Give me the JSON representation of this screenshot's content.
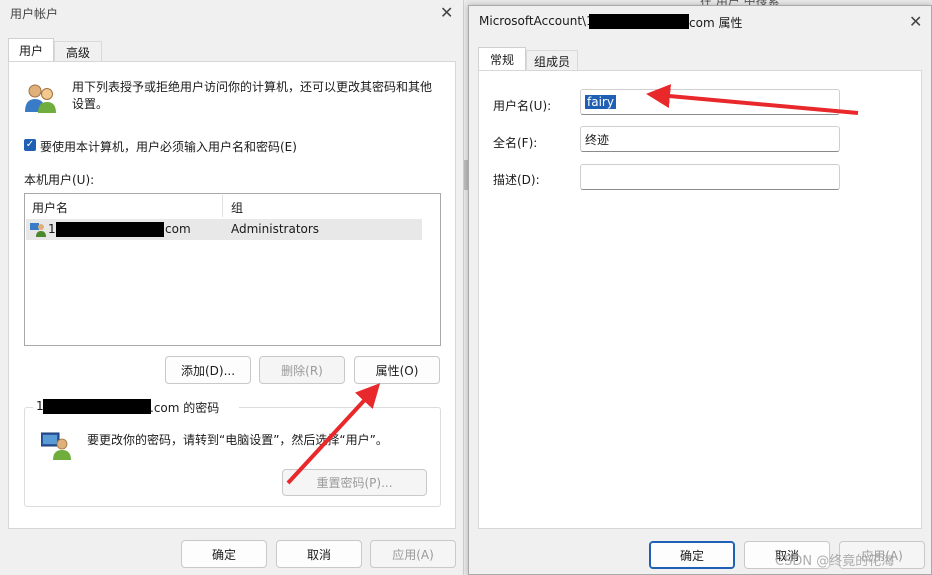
{
  "left_dialog": {
    "title": "用户帐户",
    "tabs": [
      "用户",
      "高级"
    ],
    "intro": "用下列表授予或拒绝用户访问你的计算机，还可以更改其密码和其他设置。",
    "checkbox_label": "要使用本计算机，用户必须输入用户名和密码(E)",
    "list_label": "本机用户(U):",
    "columns": [
      "用户名",
      "组"
    ],
    "rows": [
      {
        "prefix": "1",
        "suffix": "com",
        "group": "Administrators"
      }
    ],
    "buttons": {
      "add": "添加(D)...",
      "remove": "删除(R)",
      "properties": "属性(O)"
    },
    "password_group": {
      "title_prefix": "1",
      "title_suffix": ".com 的密码",
      "text": "要更改你的密码，请转到“电脑设置”，然后选择“用户”。",
      "reset": "重置密码(P)..."
    },
    "footer": {
      "ok": "确定",
      "cancel": "取消",
      "apply": "应用(A)"
    }
  },
  "right_dialog": {
    "title_prefix": "MicrosoftAccount\\1",
    "title_suffix": "com 属性",
    "tabs": [
      "常规",
      "组成员"
    ],
    "fields": [
      {
        "label": "用户名(U):",
        "value": "fairy"
      },
      {
        "label": "全名(F):",
        "value": "终迹"
      },
      {
        "label": "描述(D):",
        "value": ""
      }
    ],
    "footer": {
      "ok": "确定",
      "cancel": "取消",
      "apply": "应用(A)"
    }
  },
  "background_text": "在 用户 中搜索",
  "watermark": "CSDN @终竟的花海"
}
